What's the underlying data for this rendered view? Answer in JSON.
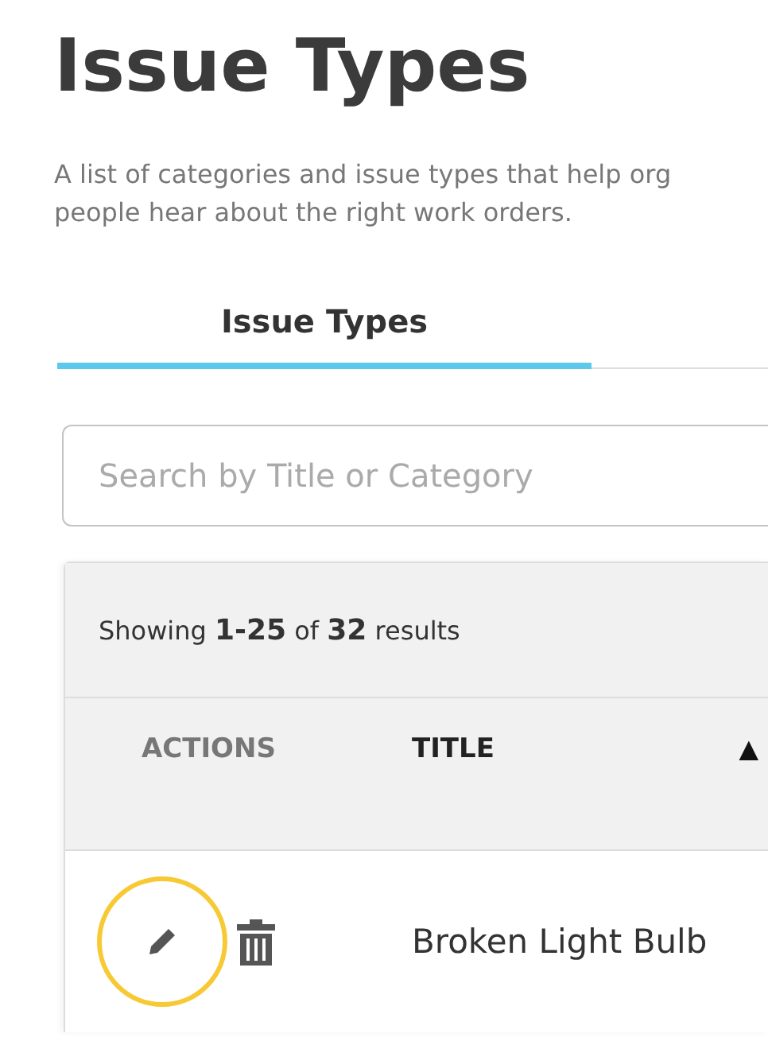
{
  "page": {
    "title": "Issue Types",
    "description_lines": [
      "A list of categories and issue types that help org",
      "people hear about the right work orders."
    ]
  },
  "tabs": [
    {
      "label": "Issue Types",
      "selected": true
    }
  ],
  "search": {
    "placeholder": "Search by Title or Category"
  },
  "table": {
    "summary": "Showing **1-25** of **32** results",
    "columns": [
      {
        "label": "ACTIONS",
        "sorted": false
      },
      {
        "label": "TITLE",
        "sorted": true
      }
    ],
    "sort_indicator": "▲",
    "rows": [
      {
        "title": "Broken Light Bulb",
        "edit_focused": true
      }
    ]
  }
}
